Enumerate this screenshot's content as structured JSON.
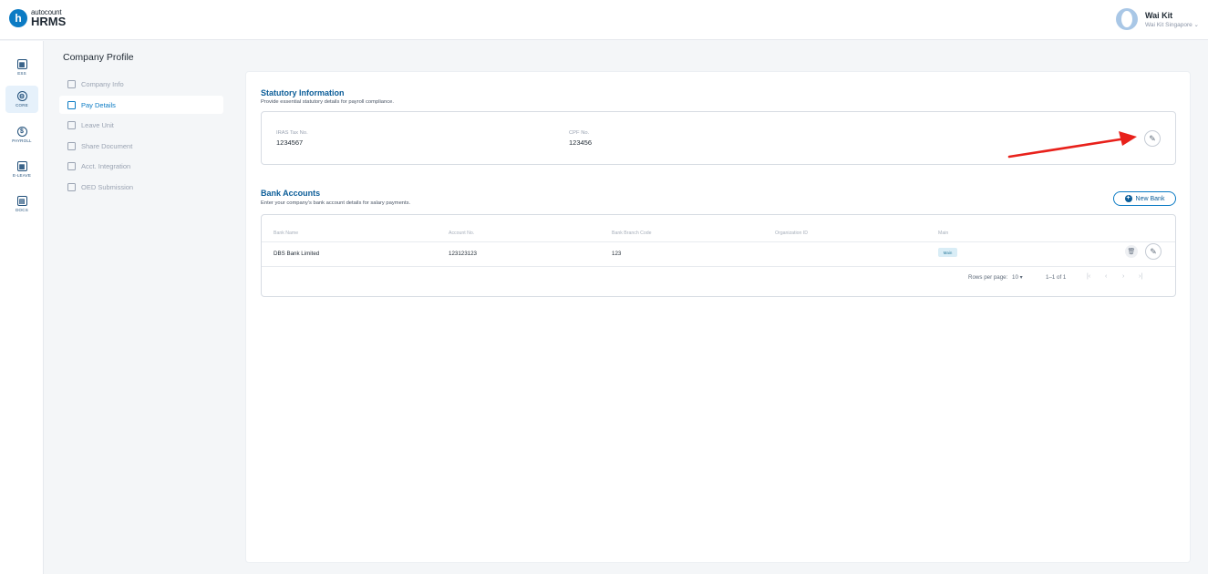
{
  "brand": {
    "small": "autocount",
    "big": "HRMS",
    "mark": "h",
    "accent": "#0b7bc4"
  },
  "user": {
    "name": "Wai Kit",
    "company": "Wai Kit Singapore ⌄"
  },
  "rail": [
    {
      "label": "ESS",
      "icon": "calculator-icon",
      "glyph": "▦"
    },
    {
      "label": "CORE",
      "icon": "settings-icon",
      "glyph": "⚙"
    },
    {
      "label": "PAYROLL",
      "icon": "dollar-icon",
      "glyph": "$"
    },
    {
      "label": "E-LEAVE",
      "icon": "calendar-icon",
      "glyph": "▦"
    },
    {
      "label": "DOCS",
      "icon": "document-icon",
      "glyph": "▤"
    }
  ],
  "sidenav": {
    "title": "Company Profile",
    "items": [
      {
        "label": "Company Info",
        "icon": "home-icon"
      },
      {
        "label": "Pay Details",
        "icon": "pay-details-icon"
      },
      {
        "label": "Leave Unit",
        "icon": "leave-unit-icon"
      },
      {
        "label": "Share Document",
        "icon": "share-document-icon"
      },
      {
        "label": "Acct. Integration",
        "icon": "integration-icon"
      },
      {
        "label": "OED Submission",
        "icon": "submission-icon"
      }
    ]
  },
  "statutory": {
    "title": "Statutory Information",
    "subtitle": "Provide essential statutory details for payroll compliance.",
    "iras_label": "IRAS Tax No.",
    "iras_value": "1234567",
    "cpf_label": "CPF No.",
    "cpf_value": "123456",
    "edit_glyph": "✎"
  },
  "bank": {
    "title": "Bank Accounts",
    "subtitle": "Enter your company's bank account details for salary payments.",
    "new_button": "New Bank",
    "columns": [
      "Bank Name",
      "Account No.",
      "Bank Branch Code",
      "Organization ID",
      "Main"
    ],
    "rows": [
      {
        "bank_name": "DBS Bank Limited",
        "account_no": "123123123",
        "branch_code": "123",
        "organization_id": "",
        "main": "Main"
      }
    ],
    "pager": {
      "rows_per_page_label": "Rows per page:",
      "rows_per_page": "10 ▾",
      "range": "1–1 of 1"
    }
  },
  "annotation_color": "#e8211b"
}
